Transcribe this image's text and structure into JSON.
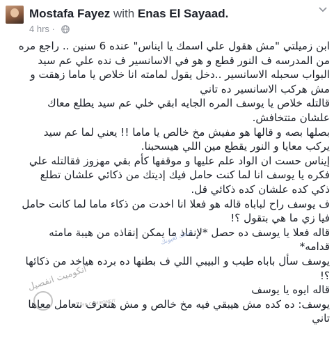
{
  "post": {
    "author": "Mostafa Fayez",
    "with_word": "with",
    "tagged": "Enas El Sayaad.",
    "timestamp": "4 hrs ·",
    "privacy_icon": "globe-icon",
    "menu_icon": "chevron-down-icon",
    "lines": [
      "ابن زميلتي \"مش هقول علي اسمك يا ايناس\" عنده 6 سنين .. راجع مره",
      "من المدرسه ف النور قطع و هو في الاسانسير ف نده علي عم سيد",
      "البواب سحبله الاسانسير ..دخل يقول لمامته انا خلاص يا ماما زهقت و",
      "مش هركب الاسانسير ده تاني",
      "قالتله خلاص يا يوسف المره الجايه ابقي خلي عم سيد يطلع معاك",
      "علشان متتخافش.",
      "بصلها بصه و قالها هو مفيش مخ خالص يا ماما !! يعني لما عم سيد",
      "يركب معايا و النور يقطع مين اللي هيسحبنا.",
      "إيناس حست ان الواد علم عليها و موقفها كأم بقي مهزوز فقالتله علي",
      "فكره يا يوسف انا لما كنت حامل فيك إديتك من ذكائي علشان تطلع",
      "ذكي كده علشان كده ذكائي قل.",
      "ف يوسف راح لباباه قاله هو فعلا انا اخدت من ذكاء ماما لما كانت حامل",
      "فيا زي ما هي بتقول ؟!",
      "قاله فعلا يا يوسف ده حصل *لإنقاذ ما يمكن إنقاذه من هيبة مامته",
      "قدامه*",
      "يوسف سأل باباه طيب و البيبي اللي ف بطنها ده برده هياخد من ذكائها",
      "؟!",
      "قاله ايوه يا يوسف",
      "يوسف: ده كده مش هيبقي فيه مخ خالص و مش هنعرف نتعامل معاها",
      "تاني"
    ]
  },
  "watermark": {
    "main": "انكوميت انفصيل",
    "small": "FB.COM/KOMEIT",
    "ribbon": "ضحك لعيونك"
  }
}
